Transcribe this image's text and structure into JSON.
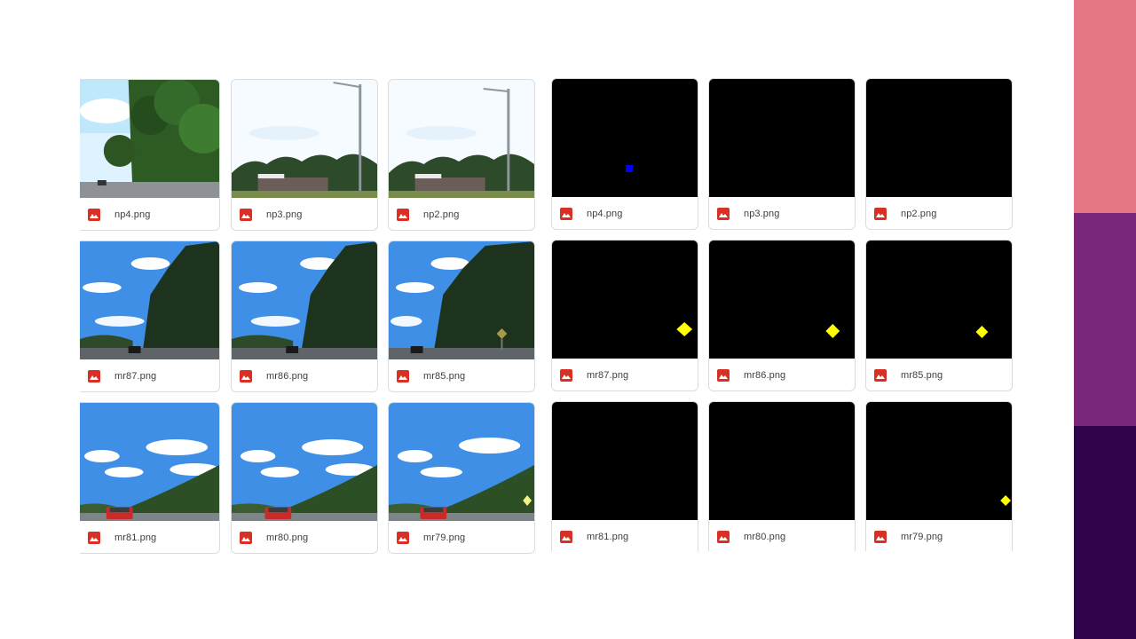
{
  "left_grid": {
    "rows": [
      [
        {
          "name": "np4.png",
          "scene": "trees-left"
        },
        {
          "name": "np3.png",
          "scene": "station"
        },
        {
          "name": "np2.png",
          "scene": "station"
        }
      ],
      [
        {
          "name": "mr87.png",
          "scene": "forest-road"
        },
        {
          "name": "mr86.png",
          "scene": "forest-road"
        },
        {
          "name": "mr85.png",
          "scene": "forest-road-sign"
        }
      ],
      [
        {
          "name": "mr81.png",
          "scene": "highway-car"
        },
        {
          "name": "mr80.png",
          "scene": "highway-car"
        },
        {
          "name": "mr79.png",
          "scene": "highway-car-sign"
        }
      ]
    ]
  },
  "right_grid": {
    "rows": [
      [
        {
          "name": "np4.png",
          "mask": "blue-square"
        },
        {
          "name": "np3.png",
          "mask": "none"
        },
        {
          "name": "np2.png",
          "mask": "none"
        }
      ],
      [
        {
          "name": "mr87.png",
          "mask": "yellow-diamond"
        },
        {
          "name": "mr86.png",
          "mask": "yellow-diamond"
        },
        {
          "name": "mr85.png",
          "mask": "yellow-diamond"
        }
      ],
      [
        {
          "name": "mr81.png",
          "mask": "none"
        },
        {
          "name": "mr80.png",
          "mask": "none"
        },
        {
          "name": "mr79.png",
          "mask": "yellow-diamond-edge"
        }
      ]
    ]
  },
  "colors": {
    "file_icon": "#d93025",
    "accent_stripes": [
      "#e57784",
      "#7b2779",
      "#30044a"
    ],
    "mask_background": "#000000",
    "mask_yellow": "#ffff00",
    "mask_blue": "#0000ff"
  }
}
